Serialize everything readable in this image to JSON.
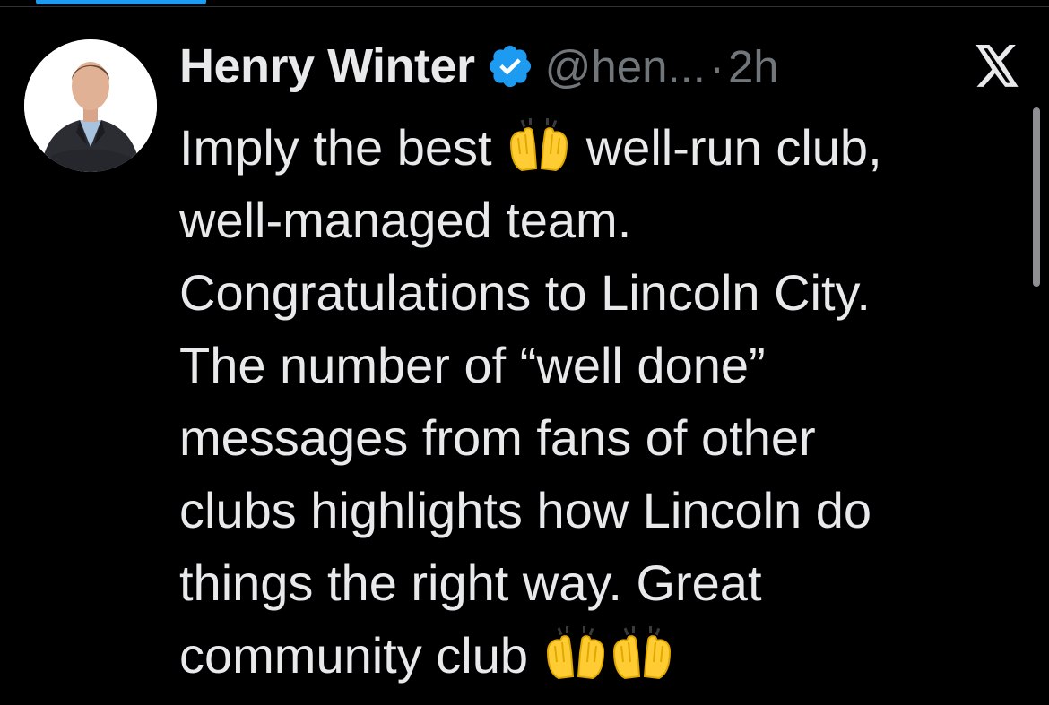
{
  "tweet": {
    "author": {
      "display_name": "Henry Winter",
      "handle": "@hen...",
      "separator": "·",
      "timestamp": "2h",
      "verified_icon": "verified-badge-icon",
      "avatar_icon": "profile-photo"
    },
    "lines": [
      {
        "pre": "Imply the best ",
        "emoji": "raising-hands-emoji",
        "post": " well-run club,"
      },
      {
        "text": "well-managed team."
      },
      {
        "text": "Congratulations to Lincoln City."
      },
      {
        "text": "The number of “well done”"
      },
      {
        "text": "messages from fans of other"
      },
      {
        "text": "clubs highlights how Lincoln do"
      },
      {
        "text": "things the right way. Great"
      },
      {
        "pre": "community club ",
        "emoji_count": 2,
        "emoji": "raising-hands-emoji"
      }
    ]
  },
  "platform_logo": "x-logo-icon",
  "colors": {
    "background": "#000000",
    "primary_text": "#e7e9ea",
    "secondary_text": "#71767b",
    "accent": "#1d9bf0",
    "emoji_yellow": "#ffcc33"
  }
}
